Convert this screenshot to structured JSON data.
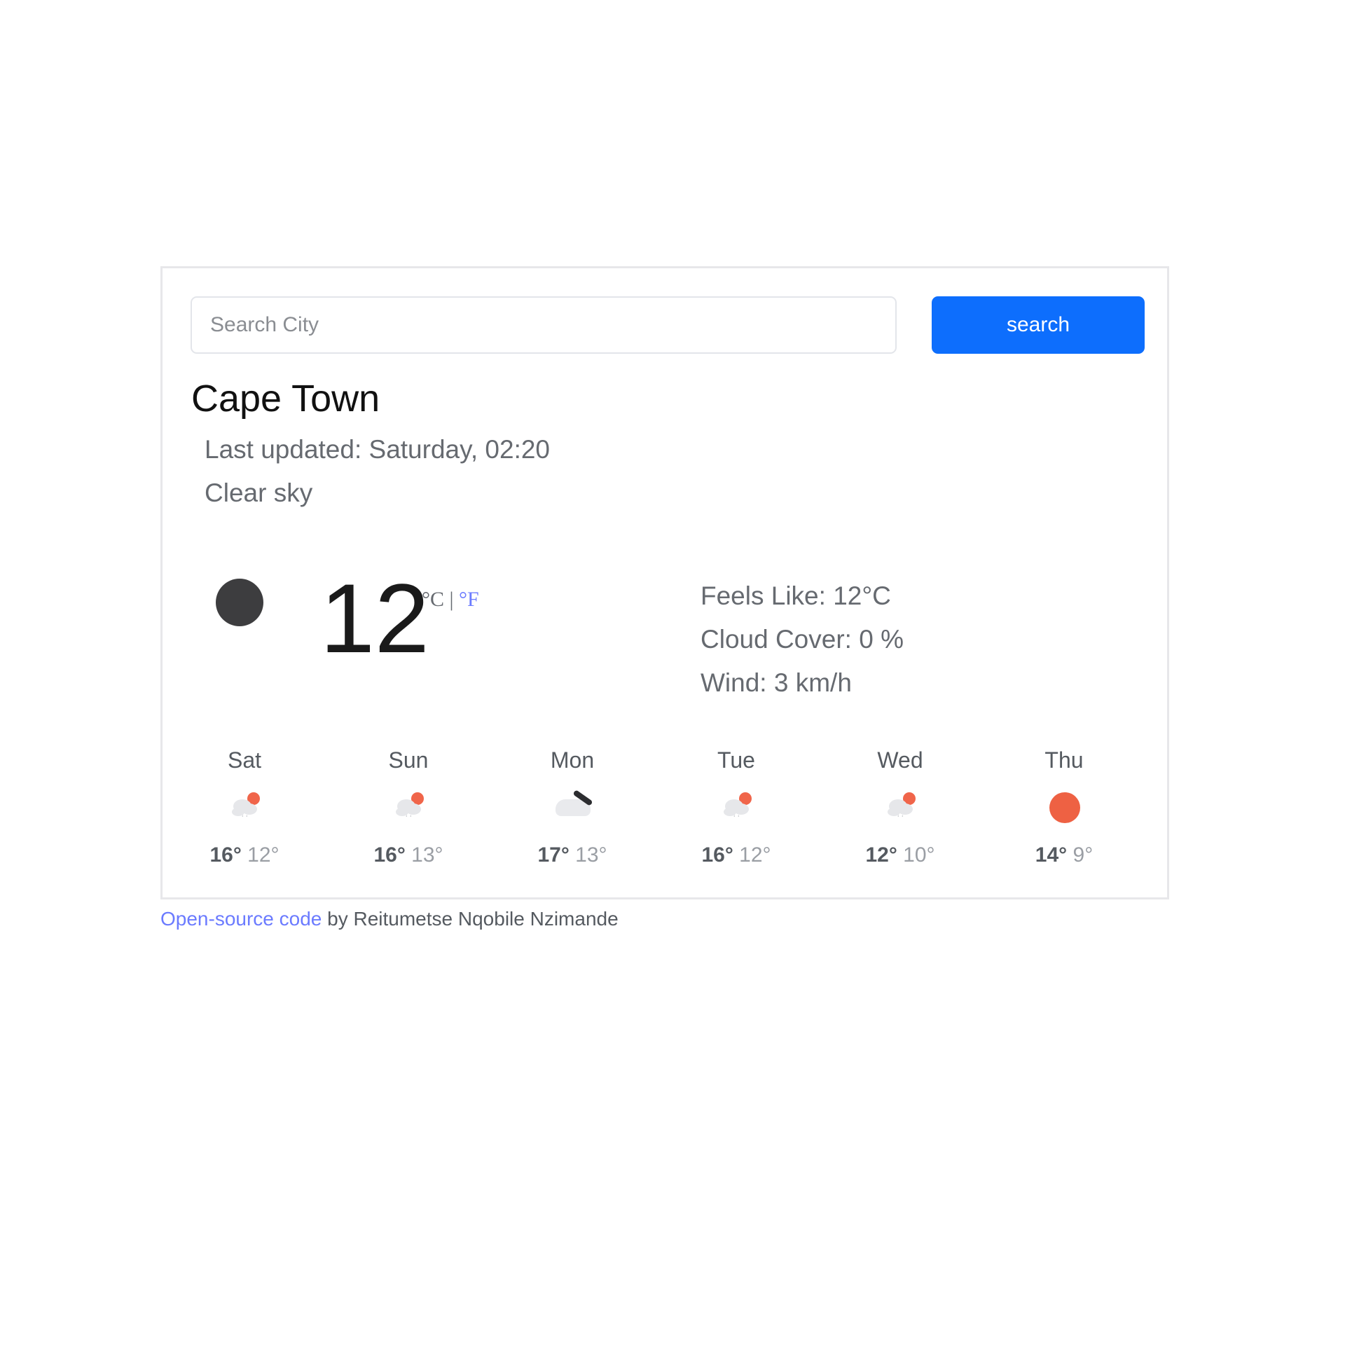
{
  "search": {
    "placeholder": "Search City",
    "button_label": "search"
  },
  "current": {
    "city": "Cape Town",
    "last_updated": "Last updated: Saturday, 02:20",
    "description": "Clear sky",
    "icon": "clear-night-icon",
    "temperature": "12",
    "unit_celsius": "°C",
    "unit_separator": "|",
    "unit_fahrenheit": "°F",
    "feels_like": "Feels Like: 12°C",
    "cloud_cover": "Cloud Cover: 0 %",
    "wind": "Wind: 3 km/h"
  },
  "forecast": [
    {
      "day": "Sat",
      "icon": "rain-sun-icon",
      "max": "16°",
      "min": "12°"
    },
    {
      "day": "Sun",
      "icon": "rain-sun-icon",
      "max": "16°",
      "min": "13°"
    },
    {
      "day": "Mon",
      "icon": "cloudy-icon",
      "max": "17°",
      "min": "13°"
    },
    {
      "day": "Tue",
      "icon": "rain-sun-icon",
      "max": "16°",
      "min": "12°"
    },
    {
      "day": "Wed",
      "icon": "rain-sun-icon",
      "max": "12°",
      "min": "10°"
    },
    {
      "day": "Thu",
      "icon": "sun-icon",
      "max": "14°",
      "min": "9°"
    }
  ],
  "footer": {
    "link_text": "Open-source code",
    "byline": " by Reitumetse Nqobile Nzimande"
  },
  "colors": {
    "accent": "#0d6efd",
    "link": "#6b7bff",
    "sun": "#ee6143",
    "moon": "#3d3d3f"
  }
}
